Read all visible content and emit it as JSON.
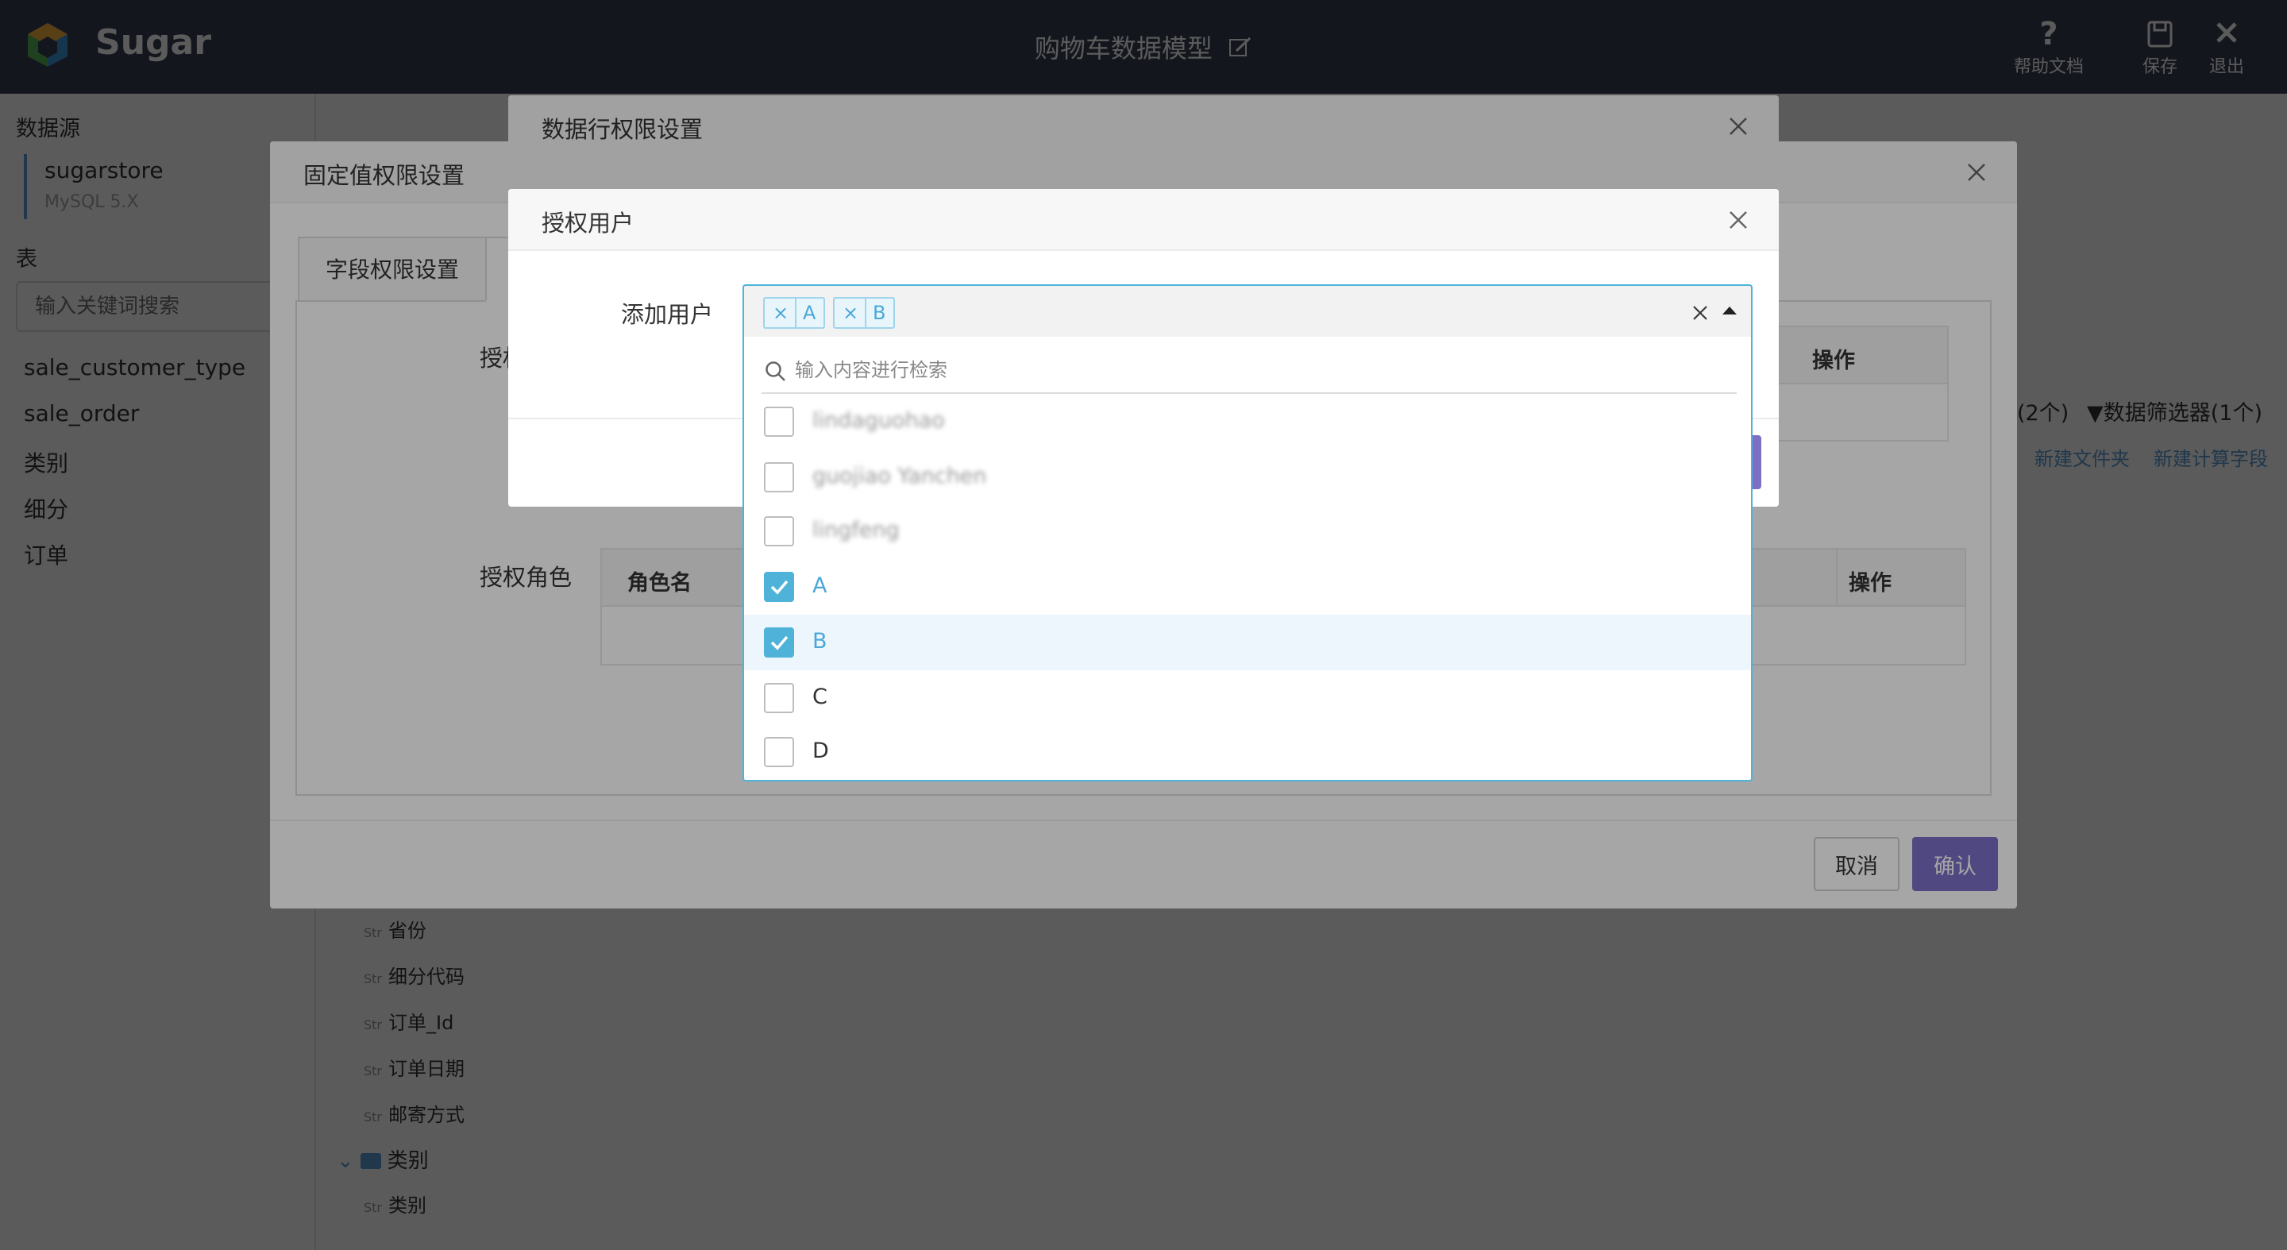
{
  "app": {
    "brand": "Sugar",
    "doc_title": "购物车数据模型",
    "actions": {
      "help": "帮助文档",
      "save": "保存",
      "exit": "退出"
    },
    "colors": {
      "topbar": "#3a3f57",
      "accent": "#4fb3d9",
      "primary": "#7b6fc6"
    }
  },
  "sidebar": {
    "datasource_heading": "数据源",
    "datasource_name": "sugarstore",
    "datasource_type": "MySQL 5.X",
    "tables_heading": "表",
    "search_placeholder": "输入关键词搜索",
    "tables": [
      "sale_customer_type",
      "sale_order",
      "类别",
      "细分",
      "订单"
    ]
  },
  "background": {
    "tool_counts": "(2个)",
    "filter_label": "数据筛选器(1个)",
    "new_folder": "新建文件夹",
    "new_calc_field": "新建计算字段",
    "field_type": "Str",
    "fields": [
      "省份",
      "细分代码",
      "订单_Id",
      "订单日期",
      "邮寄方式"
    ],
    "folder_label": "类别",
    "folder_fields": [
      "类别"
    ]
  },
  "row_dialog": {
    "title": "数据行权限设置"
  },
  "fixed_dialog": {
    "title": "固定值权限设置",
    "tab_field": "字段权限设置",
    "label_users_partial": "授权",
    "users_table_action": "操作",
    "label_roles": "授权角色",
    "roles_col_name": "角色名",
    "roles_col_action": "操作",
    "cancel": "取消",
    "confirm": "确认"
  },
  "auth_dialog": {
    "title": "授权用户",
    "add_user_label": "添加用户",
    "selected_tags": [
      "A",
      "B"
    ],
    "tag_remove": "×",
    "search_placeholder": "输入内容进行检索",
    "options": [
      {
        "label": "lindaguohao",
        "checked": false,
        "blurred": true
      },
      {
        "label": "guojiao Yanchen",
        "checked": false,
        "blurred": true
      },
      {
        "label": "lingfeng",
        "checked": false,
        "blurred": true
      },
      {
        "label": "A",
        "checked": true,
        "blurred": false
      },
      {
        "label": "B",
        "checked": true,
        "blurred": false
      },
      {
        "label": "C",
        "checked": false,
        "blurred": false
      },
      {
        "label": "D",
        "checked": false,
        "blurred": false
      }
    ]
  }
}
